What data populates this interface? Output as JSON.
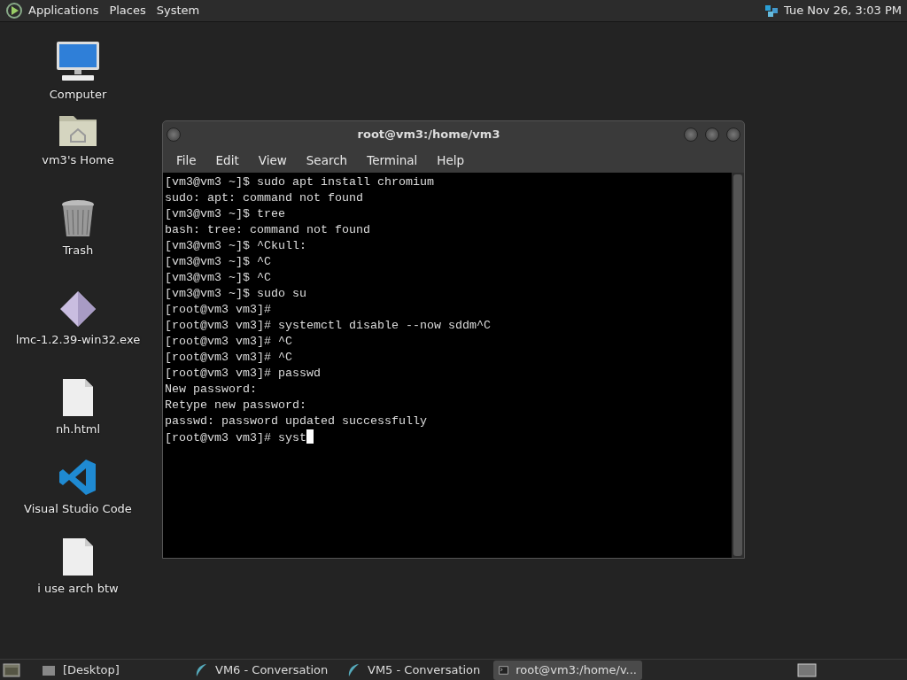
{
  "top_panel": {
    "menus": [
      "Applications",
      "Places",
      "System"
    ],
    "clock": "Tue Nov 26,  3:03 PM"
  },
  "desktop_icons": [
    {
      "kind": "computer",
      "label": "Computer"
    },
    {
      "kind": "home",
      "label": "vm3's Home"
    },
    {
      "kind": "trash",
      "label": "Trash"
    },
    {
      "kind": "diamond",
      "label": "lmc-1.2.39-win32.exe"
    },
    {
      "kind": "file",
      "label": "nh.html"
    },
    {
      "kind": "vscode",
      "label": "Visual Studio Code"
    },
    {
      "kind": "file",
      "label": "i use arch btw"
    }
  ],
  "terminal": {
    "title": "root@vm3:/home/vm3",
    "menus": [
      "File",
      "Edit",
      "View",
      "Search",
      "Terminal",
      "Help"
    ],
    "lines": [
      {
        "text": "[vm3@vm3 ~]$ sudo apt install chromium",
        "cursor": false
      },
      {
        "text": "sudo: apt: command not found",
        "cursor": false
      },
      {
        "text": "[vm3@vm3 ~]$ tree",
        "cursor": false
      },
      {
        "text": "bash: tree: command not found",
        "cursor": false
      },
      {
        "text": "[vm3@vm3 ~]$ ^Ckull:",
        "cursor": false
      },
      {
        "text": "[vm3@vm3 ~]$ ^C",
        "cursor": false
      },
      {
        "text": "[vm3@vm3 ~]$ ^C",
        "cursor": false
      },
      {
        "text": "[vm3@vm3 ~]$ sudo su",
        "cursor": false
      },
      {
        "text": "[root@vm3 vm3]#",
        "cursor": false
      },
      {
        "text": "[root@vm3 vm3]# systemctl disable --now sddm^C",
        "cursor": false
      },
      {
        "text": "[root@vm3 vm3]# ^C",
        "cursor": false
      },
      {
        "text": "[root@vm3 vm3]# ^C",
        "cursor": false
      },
      {
        "text": "[root@vm3 vm3]# passwd",
        "cursor": false
      },
      {
        "text": "New password:",
        "cursor": false
      },
      {
        "text": "Retype new password:",
        "cursor": false
      },
      {
        "text": "passwd: password updated successfully",
        "cursor": false
      },
      {
        "text": "[root@vm3 vm3]# syst",
        "cursor": true
      }
    ]
  },
  "taskbar": [
    {
      "kind": "folder",
      "label": "[Desktop]",
      "selected": false
    },
    {
      "kind": "chat",
      "label": "VM6 - Conversation",
      "selected": false
    },
    {
      "kind": "chat",
      "label": "VM5 - Conversation",
      "selected": false
    },
    {
      "kind": "terminal",
      "label": "root@vm3:/home/v...",
      "selected": true
    }
  ]
}
